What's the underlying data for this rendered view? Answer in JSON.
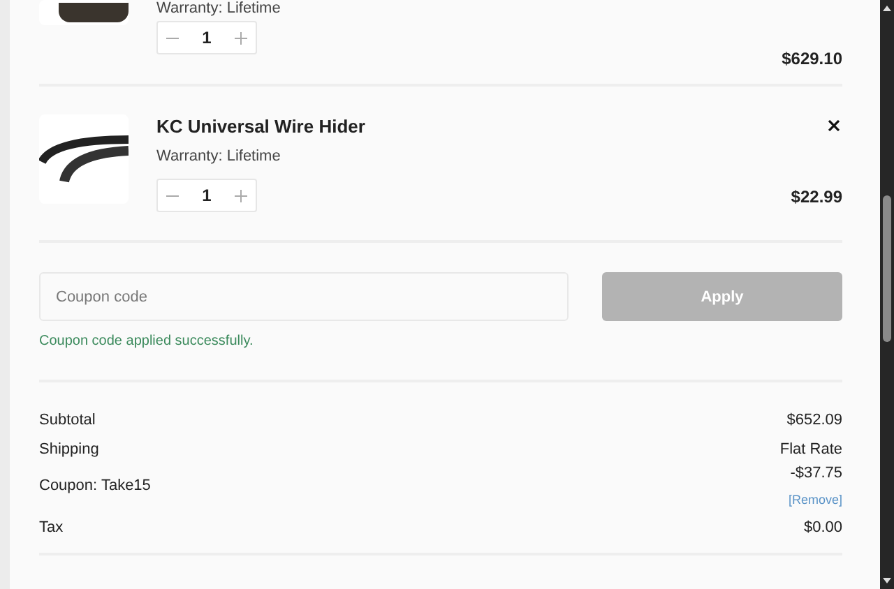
{
  "cart_items": [
    {
      "warranty": "Warranty: Lifetime",
      "quantity": "1",
      "price": "$629.10",
      "removable": false
    },
    {
      "name": "KC Universal Wire Hider",
      "warranty": "Warranty: Lifetime",
      "quantity": "1",
      "price": "$22.99",
      "removable": true
    }
  ],
  "coupon": {
    "placeholder": "Coupon code",
    "button": "Apply",
    "button_disabled": true,
    "message": "Coupon code applied successfully."
  },
  "summary": [
    {
      "kind": "plain",
      "label": "Subtotal",
      "value": "$652.09"
    },
    {
      "kind": "plain",
      "label": "Shipping",
      "value": "Flat Rate"
    },
    {
      "kind": "coupon",
      "label": "Coupon: Take15",
      "value": "-$37.75",
      "link": "[Remove]"
    },
    {
      "kind": "plain",
      "label": "Tax",
      "value": "$0.00"
    }
  ]
}
